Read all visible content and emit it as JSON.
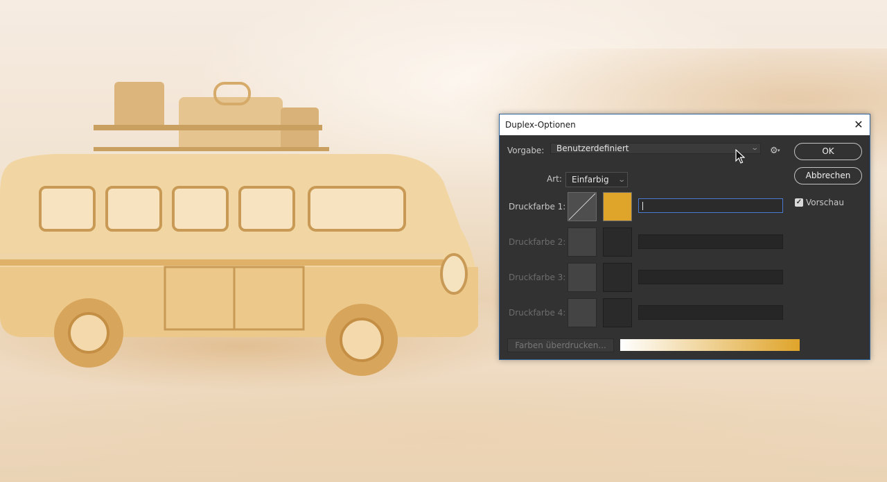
{
  "dialog": {
    "title": "Duplex-Optionen",
    "close_glyph": "✕",
    "preset_label": "Vorgabe:",
    "preset_value": "Benutzerdefiniert",
    "type_label": "Art:",
    "type_value": "Einfarbig",
    "ok_label": "OK",
    "cancel_label": "Abbrechen",
    "preview_label": "Vorschau",
    "preview_checked": true,
    "inks": [
      {
        "label": "Druckfarbe 1:",
        "color": "#dfa42a",
        "enabled": true,
        "name": ""
      },
      {
        "label": "Druckfarbe 2:",
        "enabled": false,
        "name": ""
      },
      {
        "label": "Druckfarbe 3:",
        "enabled": false,
        "name": ""
      },
      {
        "label": "Druckfarbe 4:",
        "enabled": false,
        "name": ""
      }
    ],
    "overprint_label": "Farben überdrucken...",
    "ramp_colors": [
      "#ffffff",
      "#dfa42a"
    ]
  },
  "icons": {
    "gear": "gear-icon",
    "close": "close-icon",
    "checkbox": "checkmark-icon"
  }
}
